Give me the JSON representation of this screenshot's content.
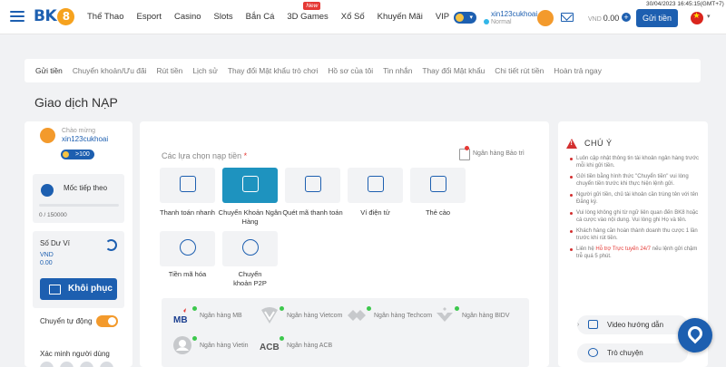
{
  "brand": {
    "logo": "BK8",
    "accent": "#1d5fb0",
    "orange": "#f39a2c",
    "selected": "#1e93bf"
  },
  "nav": {
    "items": [
      "Thể Thao",
      "Esport",
      "Casino",
      "Slots",
      "Bắn Cá",
      "3D Games",
      "Xổ Số",
      "Khuyến Mãi",
      "VIP"
    ],
    "new_badge": "New"
  },
  "header": {
    "username": "xin123cukhoai",
    "status": "Normal",
    "currency": "VND",
    "balance": "0.00",
    "deposit_label": "Gửi tiền",
    "datetime": "30/04/2023 16:45:15(GMT+7)"
  },
  "tabs": [
    "Gửi tiền",
    "Chuyển khoản/Ưu đãi",
    "Rút tiền",
    "Lịch sử",
    "Thay đổi Mật khẩu trò chơi",
    "Hồ sơ của tôi",
    "Tin nhắn",
    "Thay đổi Mật khẩu",
    "Chi tiết rút tiền",
    "Hoàn trả ngay"
  ],
  "page_title": "Giao dịch NẠP",
  "left": {
    "greeting": "Chào mừng",
    "username": "xin123cukhoai",
    "vip_badge": ">100",
    "target_label": "Mốc tiếp theo",
    "target_progress": "0 / 150000",
    "progress_fraction": 0,
    "balance_label": "Số Dư Ví",
    "balance_currency": "VND",
    "balance_amount": "0.00",
    "restore_label": "Khôi phục",
    "auto_transfer_label": "Chuyển tự động",
    "auto_transfer_on": true,
    "verify_label": "Xác minh người dùng"
  },
  "main": {
    "choose_label": "Các lựa chọn nạp tiền",
    "required_mark": "*",
    "maintenance_label": "Ngân hàng Bảo trì",
    "methods": [
      {
        "label": "Thanh toán nhanh",
        "icon": "fast-payment-icon",
        "selected": false
      },
      {
        "label": "Chuyển Khoản Ngân Hàng",
        "icon": "bank-transfer-icon",
        "selected": true
      },
      {
        "label": "Quét mã thanh toán",
        "icon": "scan-code-icon",
        "selected": false
      },
      {
        "label": "Ví điện tử",
        "icon": "qr-wallet-icon",
        "selected": false
      },
      {
        "label": "Thẻ cào",
        "icon": "scratch-card-icon",
        "selected": false
      },
      {
        "label": "Tiền mã hóa",
        "icon": "crypto-icon",
        "selected": false
      },
      {
        "label": "Chuyển khoản P2P",
        "icon": "p2p-icon",
        "selected": false
      }
    ],
    "banks": [
      {
        "name": "Ngân hàng MB",
        "logo": "MB"
      },
      {
        "name": "Ngân hàng Vietcom",
        "logo": ""
      },
      {
        "name": "Ngân hàng Techcom",
        "logo": ""
      },
      {
        "name": "Ngân hàng BIDV",
        "logo": ""
      },
      {
        "name": "Ngân hàng Vietin",
        "logo": ""
      },
      {
        "name": "Ngân hàng ACB",
        "logo": "ACB"
      }
    ]
  },
  "notice": {
    "title": "CHÚ Ý",
    "items": [
      "Luôn cập nhật thông tin tài khoản ngân hàng trước mỗi khi gửi tiền.",
      "Gửi tiền bằng hình thức \"Chuyển tiền\" vui lòng chuyển tiền trước khi thực hiện lệnh gửi.",
      "Người gửi tiền, chủ tài khoản cần trùng tên với tên Đăng ký.",
      "Vui lòng không ghi từ ngữ liên quan đến BK8 hoặc cá cược vào nội dung. Vui lòng ghi Họ và tên.",
      "Khách hàng cần hoàn thành doanh thu cược 1 lần trước khi rút tiền."
    ],
    "last_pre": "Liên hệ ",
    "last_highlight": "Hỗ trợ Trực tuyến 24/7",
    "last_post": " nếu lệnh gửi chậm trễ quá 5 phút.",
    "video_label": "Video hướng dẫn",
    "chat_label": "Trò chuyện"
  }
}
